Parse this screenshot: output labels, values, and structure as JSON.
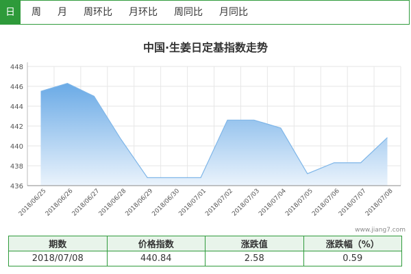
{
  "tabs": [
    {
      "label": "日",
      "active": true
    },
    {
      "label": "周",
      "active": false
    },
    {
      "label": "月",
      "active": false
    },
    {
      "label": "周环比",
      "active": false
    },
    {
      "label": "月环比",
      "active": false
    },
    {
      "label": "周同比",
      "active": false
    },
    {
      "label": "月同比",
      "active": false
    }
  ],
  "watermark": "www.jiang7.com",
  "colors": {
    "accent": "#2e9a3a",
    "line": "#7fb6e8",
    "fill_top": "#6aaae6",
    "fill_bottom": "#eaf3fc"
  },
  "chart_data": {
    "type": "area",
    "title": "中国·生姜日定基指数走势",
    "xlabel": "",
    "ylabel": "",
    "categories": [
      "2018/06/25",
      "2018/06/26",
      "2018/06/27",
      "2018/06/28",
      "2018/06/29",
      "2018/06/30",
      "2018/07/01",
      "2018/07/02",
      "2018/07/03",
      "2018/07/04",
      "2018/07/05",
      "2018/07/06",
      "2018/07/07",
      "2018/07/08"
    ],
    "values": [
      445.5,
      446.3,
      445.0,
      440.7,
      436.8,
      436.8,
      436.8,
      442.6,
      442.6,
      441.8,
      437.2,
      438.3,
      438.3,
      440.84
    ],
    "ylim": [
      436,
      448
    ],
    "yticks": [
      436,
      438,
      440,
      442,
      444,
      446,
      448
    ],
    "grid": true
  },
  "table": {
    "headers": [
      "期数",
      "价格指数",
      "涨跌值",
      "涨跌幅（%）"
    ],
    "row": [
      "2018/07/08",
      "440.84",
      "2.58",
      "0.59"
    ]
  }
}
